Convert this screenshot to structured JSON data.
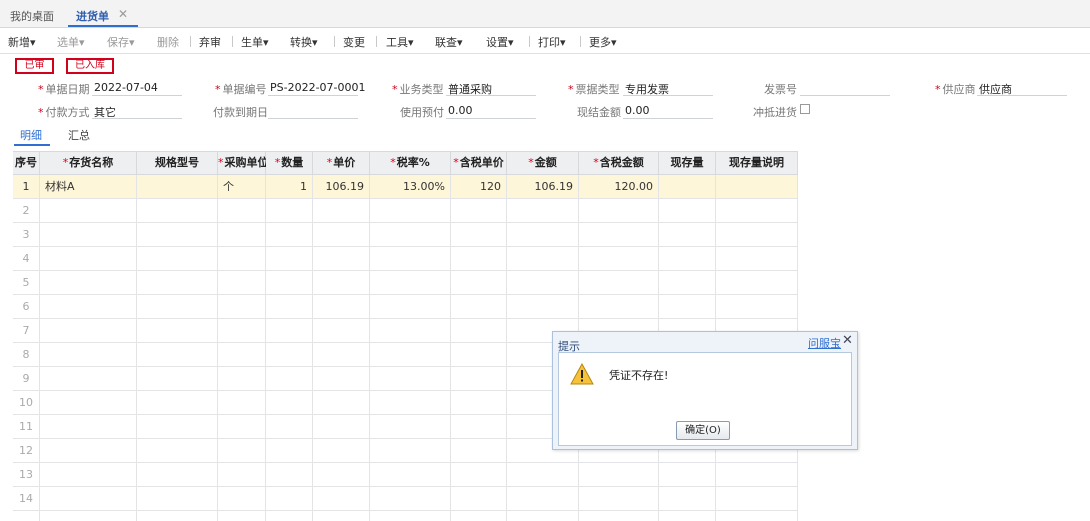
{
  "tabs": {
    "home": "我的桌面",
    "active": "进货单",
    "close": "✕"
  },
  "toolbar": {
    "new": "新增",
    "select": "选单",
    "save": "保存",
    "delete": "删除",
    "abandon": "弃审",
    "generate": "生单",
    "convert": "转换",
    "change": "变更",
    "tools": "工具",
    "query": "联查",
    "settings": "设置",
    "print": "打印",
    "more": "更多",
    "caret": "▾"
  },
  "stamps": {
    "audited": "已审",
    "stocked": "已入库"
  },
  "form": {
    "required_mark": "*",
    "doc_date_label": "单据日期",
    "doc_date": "2022-07-04",
    "doc_no_label": "单据编号",
    "doc_no": "PS-2022-07-0001",
    "biz_type_label": "业务类型",
    "biz_type": "普通采购",
    "invoice_type_label": "票据类型",
    "invoice_type": "专用发票",
    "invoice_no_label": "发票号",
    "invoice_no": "",
    "supplier_label": "供应商",
    "supplier": "供应商",
    "payment_label": "付款方式",
    "payment": "其它",
    "due_date_label": "付款到期日",
    "due_date": "",
    "prepay_label": "使用预付",
    "prepay": "0.00",
    "cash_label": "现结金额",
    "cash": "0.00",
    "offset_label": "冲抵进货"
  },
  "subtabs": {
    "detail": "明细",
    "summary": "汇总"
  },
  "grid": {
    "headers": {
      "seq": "序号",
      "name": "存货名称",
      "spec": "规格型号",
      "unit": "采购单位",
      "qty": "数量",
      "price": "单价",
      "tax_rate": "税率%",
      "tax_price": "含税单价",
      "amount": "金额",
      "tax_amount": "含税金额",
      "stock": "现存量",
      "stock_note": "现存量说明"
    },
    "rows": [
      {
        "seq": "1",
        "name": "材料A",
        "spec": "",
        "unit": "个",
        "qty": "1",
        "price": "106.19",
        "tax_rate": "13.00%",
        "tax_price": "120",
        "amount": "106.19",
        "tax_amount": "120.00",
        "stock": "",
        "stock_note": ""
      },
      {
        "seq": "2"
      },
      {
        "seq": "3"
      },
      {
        "seq": "4"
      },
      {
        "seq": "5"
      },
      {
        "seq": "6"
      },
      {
        "seq": "7"
      },
      {
        "seq": "8"
      },
      {
        "seq": "9"
      },
      {
        "seq": "10"
      },
      {
        "seq": "11"
      },
      {
        "seq": "12"
      },
      {
        "seq": "13"
      },
      {
        "seq": "14"
      },
      {
        "seq": ""
      }
    ]
  },
  "dialog": {
    "title": "提示",
    "help": "问服宝",
    "close": "✕",
    "message": "凭证不存在!",
    "ok": "确定(O)"
  },
  "colors": {
    "accent": "#2f6fd1",
    "stamp_red": "#d0021b",
    "row_highlight": "#fdf6d9"
  }
}
